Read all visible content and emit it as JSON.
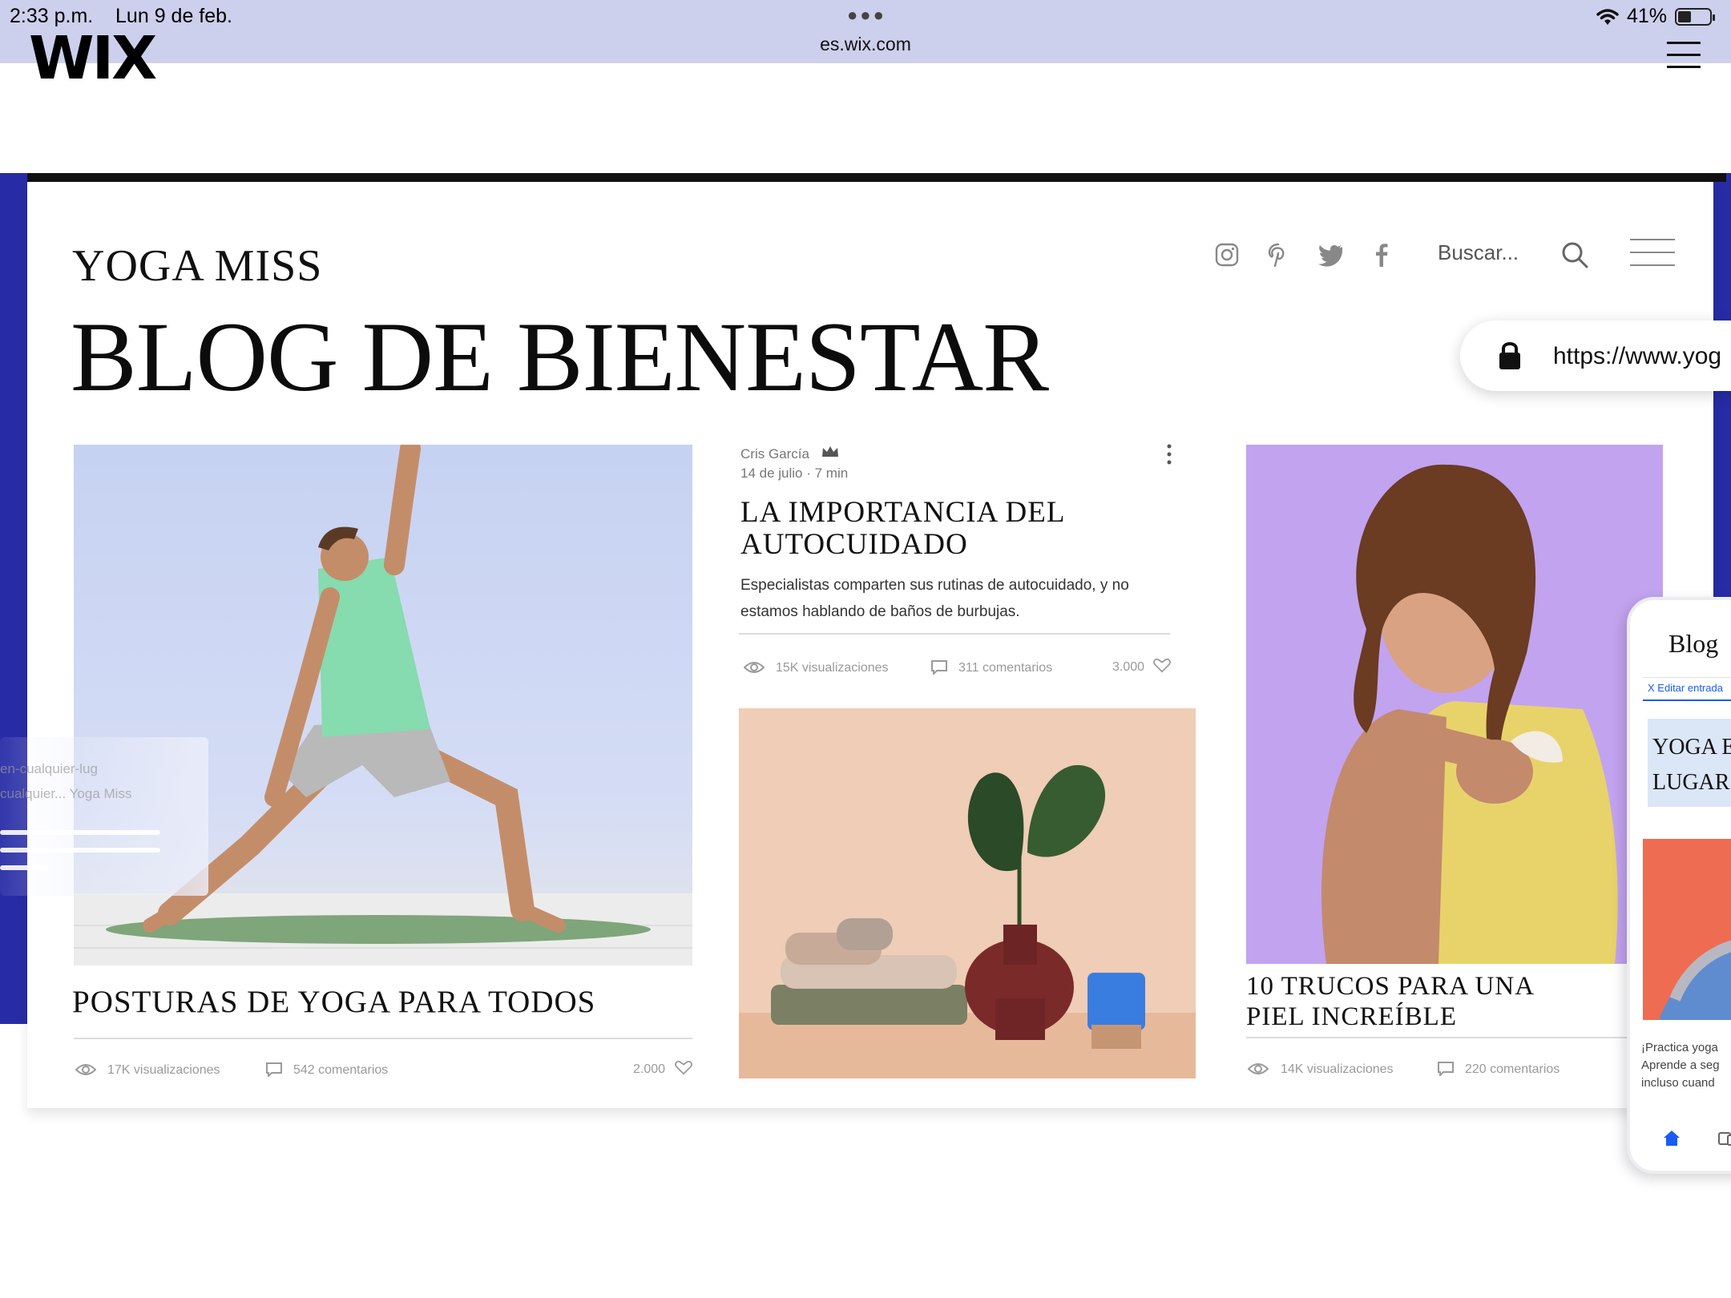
{
  "status_bar": {
    "time": "2:33 p.m.",
    "date": "Lun 9 de feb.",
    "url": "es.wix.com",
    "battery": "41%",
    "battery_level": 0.41
  },
  "wix_header": {
    "logo": "WIX"
  },
  "site": {
    "name": "YOGA MISS",
    "title": "BLOG DE BIENESTAR",
    "search_placeholder": "Buscar...",
    "url_pill": "https://www.yog"
  },
  "posts": [
    {
      "title": "POSTURAS DE YOGA PARA TODOS",
      "views": "17K visualizaciones",
      "comments": "542 comentarios",
      "likes": "2.000"
    },
    {
      "author": "Cris García",
      "date": "14 de julio",
      "read_time": "7 min",
      "title_line1": "LA IMPORTANCIA DEL",
      "title_line2": "AUTOCUIDADO",
      "excerpt": "Especialistas comparten sus rutinas de autocuidado, y no estamos hablando de baños de burbujas.",
      "views": "15K visualizaciones",
      "comments": "311 comentarios",
      "likes": "3.000"
    },
    {
      "title_line1": "10 TRUCOS PARA UNA",
      "title_line2": "PIEL INCREÍBLE",
      "views": "14K visualizaciones",
      "comments": "220 comentarios"
    }
  ],
  "floating_card": {
    "line1": "en-cualquier-lug",
    "line2": "cualquier... Yoga Miss"
  },
  "phone": {
    "title": "Blog",
    "edit_label": "X  Editar entrada",
    "banner_line1": "YOGA E",
    "banner_line2": "LUGAR",
    "text_line1": "¡Practica yoga",
    "text_line2": "Aprende a seg",
    "text_line3": "incluso cuand"
  },
  "colors": {
    "navy": "#272ca6",
    "status_bar": "#cdd0ec",
    "phone_accent": "#1a5cf2"
  }
}
